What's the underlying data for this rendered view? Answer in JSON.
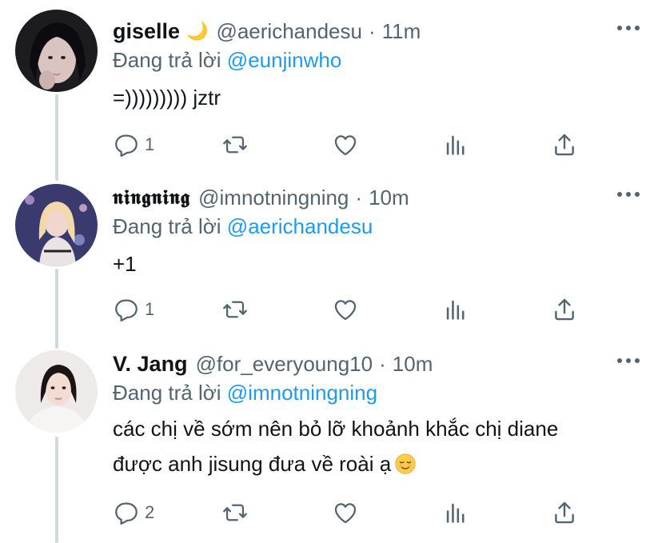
{
  "tweets": [
    {
      "name": "giselle",
      "name_suffix": "🌙",
      "handle": "@aerichandesu",
      "separator": "·",
      "time": "11m",
      "reply_prefix": "Đang trả lời",
      "reply_to": "@eunjinwho",
      "lines": [
        "=))))))))) jztr"
      ],
      "reply_count": "1"
    },
    {
      "name": "𝖓𝖎𝖓𝖌𝖓𝖎𝖓𝖌",
      "handle": "@imnotningning",
      "separator": "·",
      "time": "10m",
      "reply_prefix": "Đang trả lời",
      "reply_to": "@aerichandesu",
      "lines": [
        "+1"
      ],
      "reply_count": "1"
    },
    {
      "name": "V. Jang",
      "handle": "@for_everyoung10",
      "separator": "·",
      "time": "10m",
      "reply_prefix": "Đang trả lời",
      "reply_to": "@imnotningning",
      "lines": [
        "các chị về sớm nên bỏ lỡ khoảnh khắc chị diane",
        "được anh jisung đưa về roài ạ"
      ],
      "emoji": "relieved-face",
      "reply_count": "2"
    }
  ],
  "icons": {
    "reply": "reply-icon",
    "retweet": "retweet-icon",
    "like": "like-icon",
    "analytics": "analytics-icon",
    "share": "share-icon",
    "more": "more-icon"
  },
  "colors": {
    "mention": "#1d9bf0",
    "secondary_text": "#536471",
    "primary_text": "#0f1419",
    "thread_line": "#cfd9de"
  }
}
